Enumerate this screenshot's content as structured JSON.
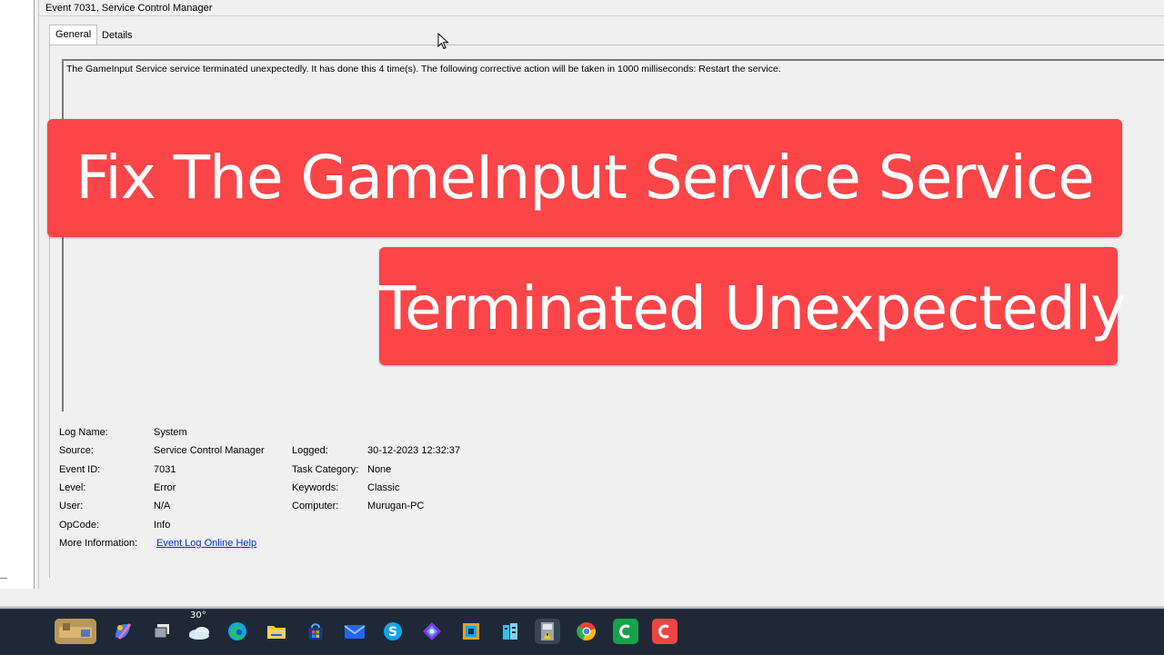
{
  "window": {
    "title": "Event 7031, Service Control Manager",
    "tabs": [
      {
        "label": "General",
        "active": true
      },
      {
        "label": "Details",
        "active": false
      }
    ],
    "description": "The GameInput Service service terminated unexpectedly.  It has done this 4 time(s).  The following corrective action will be taken in 1000 milliseconds: Restart the service.",
    "properties": {
      "log_name": {
        "label": "Log Name:",
        "value": "System"
      },
      "source": {
        "label": "Source:",
        "value": "Service Control Manager"
      },
      "logged": {
        "label": "Logged:",
        "value": "30-12-2023 12:32:37"
      },
      "event_id": {
        "label": "Event ID:",
        "value": "7031"
      },
      "task_category": {
        "label": "Task Category:",
        "value": "None"
      },
      "level": {
        "label": "Level:",
        "value": "Error"
      },
      "keywords": {
        "label": "Keywords:",
        "value": "Classic"
      },
      "user": {
        "label": "User:",
        "value": "N/A"
      },
      "computer": {
        "label": "Computer:",
        "value": "Murugan-PC"
      },
      "opcode": {
        "label": "OpCode:",
        "value": "Info"
      },
      "more_info": {
        "label": "More Information:",
        "value": "Event Log Online Help"
      }
    }
  },
  "banner": {
    "line1": "Fix The GameInput Service Service",
    "line2": "Terminated Unexpectedly",
    "color": "#fb4548"
  },
  "taskbar": {
    "weather_temp": "30°",
    "icons": [
      "widgets-icon",
      "copilot-icon",
      "task-view-icon",
      "weather-icon",
      "edge-icon",
      "file-explorer-icon",
      "microsoft-store-icon",
      "mail-icon",
      "skype-icon",
      "photos-icon",
      "app-icon-1",
      "app-icon-2",
      "event-viewer-icon",
      "chrome-icon",
      "camtasia-icon",
      "camtasia-recorder-icon"
    ]
  }
}
